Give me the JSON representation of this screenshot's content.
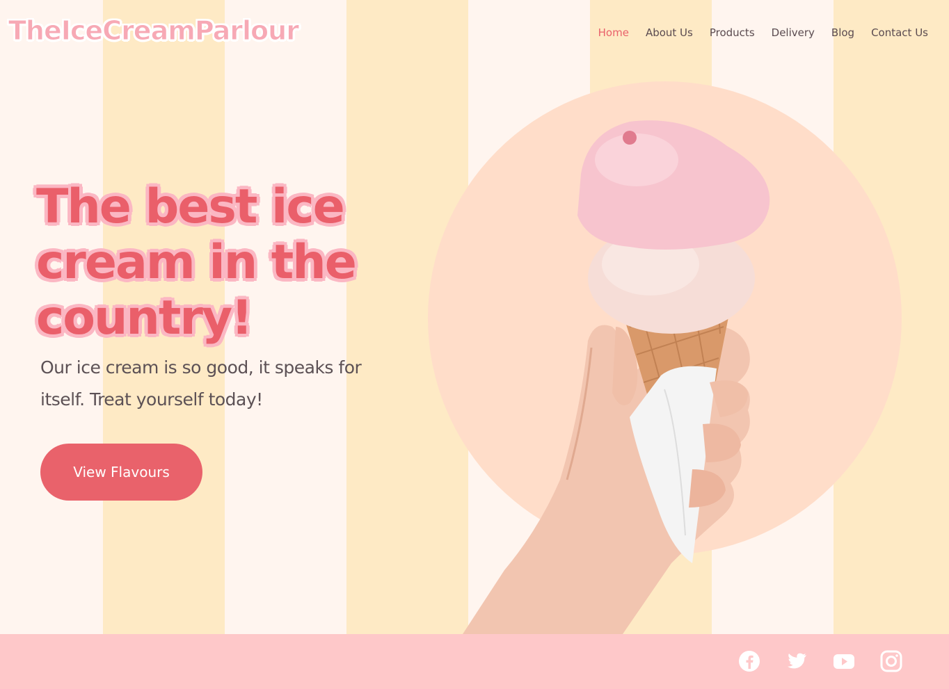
{
  "brand": {
    "logo_text": "TheIceCreamParlour"
  },
  "nav": {
    "items": [
      {
        "label": "Home",
        "active": true
      },
      {
        "label": "About Us",
        "active": false
      },
      {
        "label": "Products",
        "active": false
      },
      {
        "label": "Delivery",
        "active": false
      },
      {
        "label": "Blog",
        "active": false
      },
      {
        "label": "Contact Us",
        "active": false
      }
    ]
  },
  "hero": {
    "headline": "The best ice cream in the country!",
    "subtext": "Our ice cream is so good, it speaks for itself. Treat yourself today!",
    "cta_label": "View Flavours",
    "image_icon": "ice-cream-cone-in-hand"
  },
  "footer": {
    "social": [
      {
        "icon": "facebook-icon"
      },
      {
        "icon": "twitter-icon"
      },
      {
        "icon": "youtube-icon"
      },
      {
        "icon": "instagram-icon"
      }
    ]
  },
  "colors": {
    "accent": "#e9616b",
    "stripe_light": "#fff5ef",
    "stripe_yellow": "#feeac5",
    "circle": "#ffddc9",
    "footer": "#fec8c9"
  }
}
